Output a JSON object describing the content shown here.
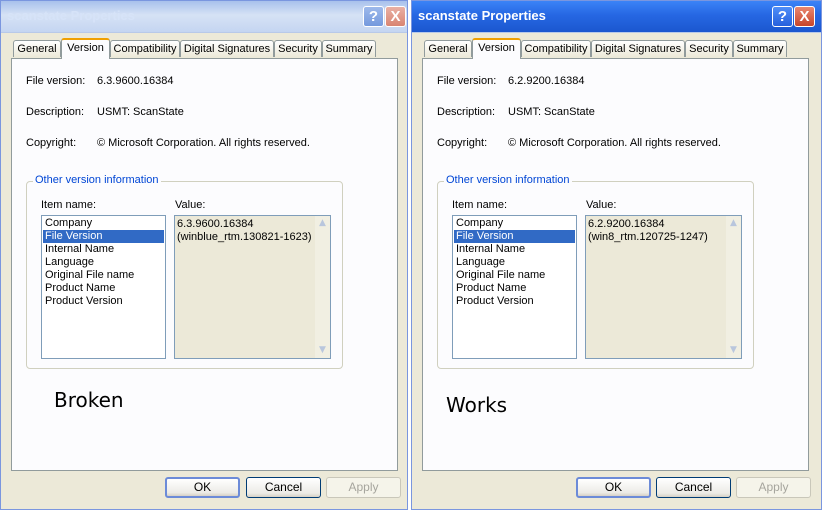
{
  "windows": [
    {
      "title": "scanstate Properties",
      "tabs": [
        "General",
        "Version",
        "Compatibility",
        "Digital Signatures",
        "Security",
        "Summary"
      ],
      "active_tab": "Version",
      "file_version_label": "File version:",
      "file_version": "6.3.9600.16384",
      "description_label": "Description:",
      "description": "USMT: ScanState",
      "copyright_label": "Copyright:",
      "copyright": "© Microsoft Corporation. All rights reserved.",
      "group_title": "Other version information",
      "item_name_label": "Item name:",
      "value_label": "Value:",
      "items": [
        "Company",
        "File Version",
        "Internal Name",
        "Language",
        "Original File name",
        "Product Name",
        "Product Version"
      ],
      "selected_item": "File Version",
      "value_line1": "6.3.9600.16384",
      "value_line2": "(winblue_rtm.130821-1623)",
      "caption": "Broken",
      "ok": "OK",
      "cancel": "Cancel",
      "apply": "Apply",
      "help_glyph": "?",
      "close_glyph": "X"
    },
    {
      "title": "scanstate Properties",
      "tabs": [
        "General",
        "Version",
        "Compatibility",
        "Digital Signatures",
        "Security",
        "Summary"
      ],
      "active_tab": "Version",
      "file_version_label": "File version:",
      "file_version": "6.2.9200.16384",
      "description_label": "Description:",
      "description": "USMT: ScanState",
      "copyright_label": "Copyright:",
      "copyright": "© Microsoft Corporation. All rights reserved.",
      "group_title": "Other version information",
      "item_name_label": "Item name:",
      "value_label": "Value:",
      "items": [
        "Company",
        "File Version",
        "Internal Name",
        "Language",
        "Original File name",
        "Product Name",
        "Product Version"
      ],
      "selected_item": "File Version",
      "value_line1": "6.2.9200.16384",
      "value_line2": "(win8_rtm.120725-1247)",
      "caption": "Works",
      "ok": "OK",
      "cancel": "Cancel",
      "apply": "Apply",
      "help_glyph": "?",
      "close_glyph": "X"
    }
  ]
}
